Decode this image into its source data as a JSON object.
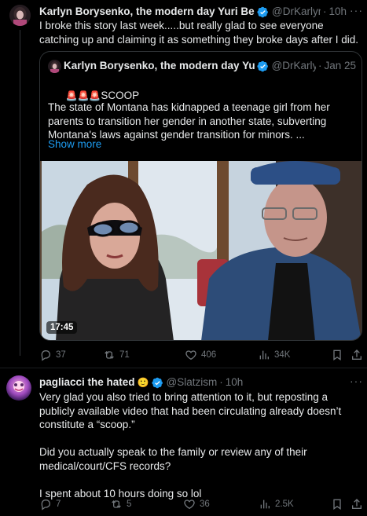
{
  "post1": {
    "author_name": "Karlyn Borysenko, the modern day Yuri Bezmenov",
    "handle": "@DrKarlynB",
    "time": "10h",
    "text": "I broke this story last week.....but really glad to see everyone catching up and claiming it as something they broke days after I did.",
    "quote": {
      "author_name": "Karlyn Borysenko, the modern day Yuri Bezmenov",
      "handle": "@DrKarlynB",
      "time": "Jan 25",
      "headline_emoji": "🚨🚨🚨",
      "headline": "SCOOP",
      "body": "The state of Montana has kidnapped a teenage girl from her parents to transition her gender in another state, subverting Montana's laws against gender transition for minors. ...",
      "show_more": "Show more",
      "video_duration": "17:45"
    },
    "actions": {
      "replies": "37",
      "reposts": "71",
      "likes": "406",
      "views": "34K"
    }
  },
  "post2": {
    "author_name": "pagliacci the hated",
    "author_emoji": "🙂",
    "handle": "@Slatzism",
    "time": "10h",
    "text": "Very glad you also tried to bring attention to it, but reposting a publicly available video that had been circulating already doesn’t constitute a “scoop.”\n\nDid you actually speak to the family or review any of their medical/court/CFS records?\n\nI spent about 10 hours doing so lol",
    "actions": {
      "replies": "7",
      "reposts": "5",
      "likes": "36",
      "views": "2.5K"
    }
  },
  "more_label": "···",
  "colors": {
    "background": "#000000",
    "accent": "#1d9bf0",
    "muted": "#71767b",
    "text": "#e7e9ea",
    "border": "#2f3336"
  }
}
